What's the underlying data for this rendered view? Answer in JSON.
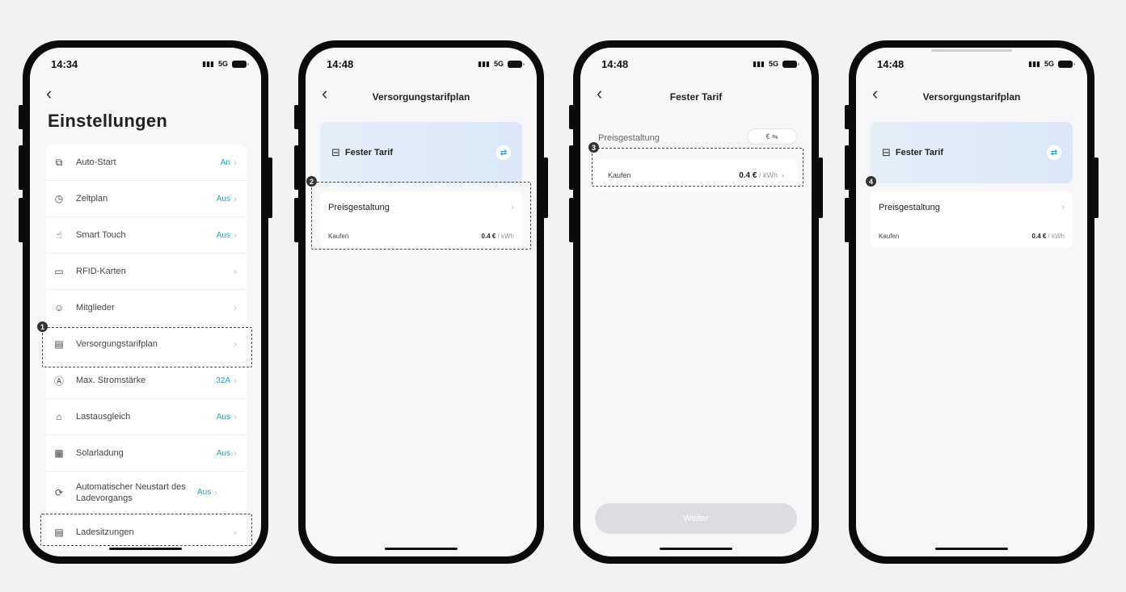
{
  "phone1": {
    "time": "14:34",
    "network": "5G",
    "title": "Einstellungen",
    "items": [
      {
        "icon": "auto-start-icon",
        "glyph": "⧉",
        "label": "Auto-Start",
        "value": "An"
      },
      {
        "icon": "clock-icon",
        "glyph": "◷",
        "label": "Zeitplan",
        "value": "Aus"
      },
      {
        "icon": "hand-touch-icon",
        "glyph": "☝",
        "label": "Smart Touch",
        "value": "Aus"
      },
      {
        "icon": "card-icon",
        "glyph": "▭",
        "label": "RFID-Karten",
        "value": ""
      },
      {
        "icon": "members-icon",
        "glyph": "☺",
        "label": "Mitglieder",
        "value": ""
      },
      {
        "icon": "tariff-icon",
        "glyph": "▤",
        "label": "Versorgungstarifplan",
        "value": ""
      },
      {
        "icon": "ampere-icon",
        "glyph": "Ⓐ",
        "label": "Max. Stromstärke",
        "value": "32A"
      },
      {
        "icon": "load-balance-icon",
        "glyph": "⌂",
        "label": "Lastausgleich",
        "value": "Aus"
      },
      {
        "icon": "solar-icon",
        "glyph": "▦",
        "label": "Solarladung",
        "value": "Aus"
      },
      {
        "icon": "restart-icon",
        "glyph": "⟳",
        "label": "Automatischer Neustart des Ladevorgangs",
        "value": "Aus"
      },
      {
        "icon": "sessions-icon",
        "glyph": "▤",
        "label": "Ladesitzungen",
        "value": ""
      }
    ],
    "badge": "1"
  },
  "phone2": {
    "time": "14:48",
    "network": "5G",
    "title": "Versorgungstarifplan",
    "tariff_label": "Fester Tarif",
    "pricing_label": "Preisgestaltung",
    "buy_label": "Kaufen",
    "price_value": "0.4 €",
    "price_unit": " / kWh",
    "badge": "2"
  },
  "phone3": {
    "time": "14:48",
    "network": "5G",
    "title": "Fester Tarif",
    "pricing_label": "Preisgestaltung",
    "currency_toggle": "€ ⇋",
    "buy_label": "Kaufen",
    "price_value": "0.4 €",
    "price_unit": " / kWh",
    "button_label": "Weiter",
    "badge": "3"
  },
  "phone4": {
    "time": "14:48",
    "network": "5G",
    "title": "Versorgungstarifplan",
    "tariff_label": "Fester Tarif",
    "pricing_label": "Preisgestaltung",
    "buy_label": "Kaufen",
    "price_value": "0.4 €",
    "price_unit": " / kWh",
    "badge": "4"
  },
  "colors": {
    "accent": "#1aa5c8",
    "card_gradient": "#e3eef8"
  }
}
